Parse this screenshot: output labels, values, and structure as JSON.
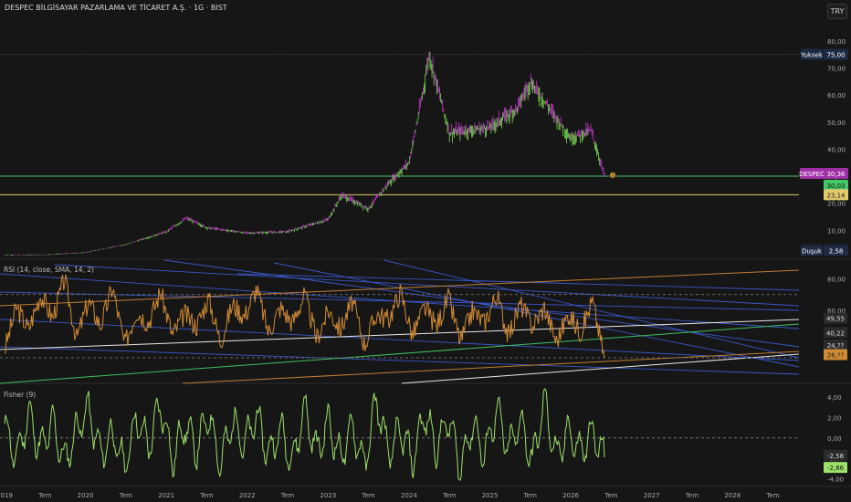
{
  "header": {
    "symbol_title": "DESPEC BİLGİSAYAR PAZARLAMA VE TİCARET A.Ş. · 1G · BIST",
    "currency_button": "TRY"
  },
  "colors": {
    "background": "#161616",
    "up_candle": "#7ed957",
    "down_candle": "#c83ad0",
    "rsi_line": "#d18a34",
    "fisher_line": "#9be069",
    "price_green_line": "#45c76a",
    "price_yellow_line": "#e2c96a",
    "trend_blue": "#3a57c9",
    "trend_orange": "#c07d35",
    "trend_white": "#e8e8e8"
  },
  "chart_data": [
    {
      "type": "candlestick",
      "pane": "price",
      "title": "DESPEC BİLGİSAYAR PAZARLAMA VE TİCARET A.Ş. · 1G · BIST",
      "ylim": [
        0,
        85
      ],
      "y_ticks": [
        "80,00",
        "70,00",
        "60,00",
        "50,00",
        "40,00",
        "30,00",
        "20,00",
        "10,00"
      ],
      "x_ticks": [
        "2019",
        "Tem",
        "2020",
        "Tem",
        "2021",
        "Tem",
        "2022",
        "Tem",
        "2023",
        "Tem",
        "2024",
        "Tem",
        "2025",
        "Tem",
        "2026",
        "Tem",
        "2027",
        "Tem",
        "2028",
        "Tem"
      ],
      "close_series": {
        "x": [
          "2019-01",
          "2019-07",
          "2020-01",
          "2020-07",
          "2021-01",
          "2021-04",
          "2021-07",
          "2022-01",
          "2022-07",
          "2023-01",
          "2023-03",
          "2023-07",
          "2023-10",
          "2024-01",
          "2024-03",
          "2024-04",
          "2024-07",
          "2025-01",
          "2025-05",
          "2025-07",
          "2026-01",
          "2026-04",
          "2026-06"
        ],
        "y": [
          0.9,
          1.0,
          1.8,
          4.8,
          9.5,
          14.5,
          11.0,
          9.0,
          9.5,
          14.0,
          23.0,
          18.0,
          27.5,
          35.0,
          60.0,
          75.0,
          46.0,
          48.0,
          55.0,
          65.0,
          44.0,
          47.0,
          30.36
        ]
      },
      "labels": {
        "high_label": "Yuksek",
        "high_value": "75,00",
        "low_label": "Duşuk",
        "low_value": "2,58",
        "symbol_tag": "DESPEC",
        "last_price": "30,36",
        "green_line_value": "30,03",
        "yellow_line_value": "23,14",
        "marker": "0"
      },
      "horizontal_lines": [
        {
          "value": 30.03,
          "color": "#45c76a"
        },
        {
          "value": 23.14,
          "color": "#e2c96a"
        },
        {
          "value": 75.0,
          "style": "dotted"
        }
      ]
    },
    {
      "type": "line",
      "pane": "rsi",
      "title": "RSI (14, close, SMA, 14, 2)",
      "ylim": [
        15,
        90
      ],
      "y_ticks": [
        "80,00",
        "60,00",
        "40,00"
      ],
      "value_labels": [
        "49,55",
        "40,22",
        "24,??",
        "26,??"
      ],
      "series": [
        {
          "name": "RSI",
          "values": [
            35,
            62,
            48,
            70,
            55,
            80,
            42,
            66,
            50,
            75,
            38,
            60,
            52,
            72,
            44,
            58,
            50,
            68,
            40,
            64,
            56,
            74,
            46,
            62,
            52,
            70,
            42,
            60,
            48,
            66,
            38,
            58,
            54,
            72,
            44,
            62,
            50,
            68,
            40,
            60,
            52,
            70,
            44,
            64,
            50,
            62,
            40,
            58,
            46,
            66,
            30
          ]
        }
      ]
    },
    {
      "type": "line",
      "pane": "fisher",
      "title": "Fisher (9)",
      "ylim": [
        -4.5,
        5.0
      ],
      "y_ticks": [
        "4,00",
        "2,00",
        "0,00",
        "-2,00",
        "-4,00"
      ],
      "value_labels": [
        "-2,58",
        "-2,86"
      ],
      "series": [
        {
          "name": "Fisher",
          "values": [
            1.5,
            -2.5,
            3.0,
            -1.5,
            2.0,
            -3.0,
            1.0,
            3.5,
            -2.0,
            0.5,
            -3.5,
            2.5,
            -1.0,
            4.2,
            -2.8,
            1.8,
            -1.5,
            3.0,
            -3.2,
            2.2,
            -0.8,
            2.8,
            -2.2,
            1.2,
            -3.0,
            3.8,
            -1.8,
            2.0,
            -2.5,
            1.5,
            -3.5,
            4.8,
            -2.0,
            1.0,
            -2.8,
            3.0,
            -1.2,
            2.5,
            -3.8,
            1.8,
            -2.2,
            3.5,
            -1.5,
            2.2,
            -3.0,
            4.6,
            -2.5,
            1.0,
            -1.8,
            0.8,
            -2.6
          ]
        }
      ]
    }
  ]
}
